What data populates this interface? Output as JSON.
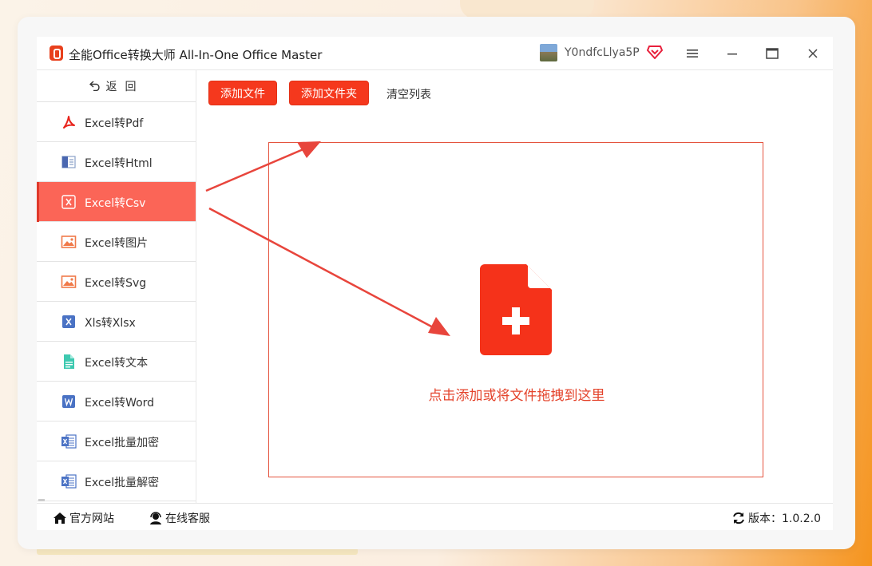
{
  "app": {
    "title": "全能Office转换大师 All-In-One Office Master"
  },
  "user": {
    "name": "Y0ndfcLlya5P"
  },
  "sidebar": {
    "back_label": "返回",
    "items": [
      {
        "label": "Excel转Pdf",
        "icon": "pdf-icon"
      },
      {
        "label": "Excel转Html",
        "icon": "html-icon"
      },
      {
        "label": "Excel转Csv",
        "icon": "csv-icon",
        "active": true
      },
      {
        "label": "Excel转图片",
        "icon": "image-icon"
      },
      {
        "label": "Excel转Svg",
        "icon": "image-icon"
      },
      {
        "label": "Xls转Xlsx",
        "icon": "excel-icon"
      },
      {
        "label": "Excel转文本",
        "icon": "text-file-icon"
      },
      {
        "label": "Excel转Word",
        "icon": "word-icon"
      },
      {
        "label": "Excel批量加密",
        "icon": "excel-file-icon"
      },
      {
        "label": "Excel批量解密",
        "icon": "excel-file-icon"
      }
    ]
  },
  "toolbar": {
    "add_file": "添加文件",
    "add_folder": "添加文件夹",
    "clear_list": "清空列表"
  },
  "dropzone": {
    "text": "点击添加或将文件拖拽到这里"
  },
  "footer": {
    "website": "官方网站",
    "support": "在线客服",
    "version": "版本：1.0.2.0"
  },
  "colors": {
    "accent": "#f5381d",
    "active_item": "#fb6557",
    "annotation_arrow": "#e8453c"
  }
}
